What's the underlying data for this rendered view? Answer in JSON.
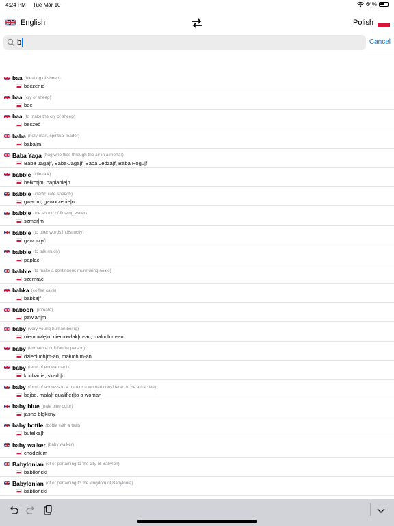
{
  "status_bar": {
    "time": "4:24 PM",
    "date": "Tue Mar 10",
    "battery_text": "64%",
    "battery_level": 0.64
  },
  "header": {
    "source_language": "English",
    "target_language": "Polish"
  },
  "search": {
    "value": "b",
    "placeholder": "",
    "cancel_label": "Cancel"
  },
  "results": [
    {
      "headword": "baa",
      "note": "(bleating of sheep)",
      "translation": "beczenie"
    },
    {
      "headword": "baa",
      "note": "(cry of sheep)",
      "translation": "bee"
    },
    {
      "headword": "baa",
      "note": "(to make the cry of sheep)",
      "translation": "beczeć"
    },
    {
      "headword": "baba",
      "note": "(holy man, spiritual leader)",
      "translation": "baba|m"
    },
    {
      "headword": "Baba Yaga",
      "note": "(hag who flies through the air in a mortar)",
      "translation": "Baba Jaga|f, Baba-Jaga|f, Baba Jędza|f, Baba Rogu|f"
    },
    {
      "headword": "babble",
      "note": "(idle talk)",
      "translation": "bełkot|m, paplanie|n"
    },
    {
      "headword": "babble",
      "note": "(inarticulate speech)",
      "translation": "gwar|m, gaworzenie|n"
    },
    {
      "headword": "babble",
      "note": "(the sound of flowing water)",
      "translation": "szmer|m"
    },
    {
      "headword": "babble",
      "note": "(to utter words indistinctly)",
      "translation": "gaworzyć"
    },
    {
      "headword": "babble",
      "note": "(to talk much)",
      "translation": "paplać"
    },
    {
      "headword": "babble",
      "note": "(to make a continuous murmuring noise)",
      "translation": "szemrać"
    },
    {
      "headword": "babka",
      "note": "(coffee cake)",
      "translation": "babka|f"
    },
    {
      "headword": "baboon",
      "note": "(primate)",
      "translation": "pawian|m"
    },
    {
      "headword": "baby",
      "note": "(very young human being)",
      "translation": "niemowlę|n, niemowlak|m-an, maluch|m-an"
    },
    {
      "headword": "baby",
      "note": "(immature or infantile person)",
      "translation": "dzieciuch|m-an, małuch|m-an"
    },
    {
      "headword": "baby",
      "note": "(term of endearment)",
      "translation": "kochanie, skarb|n"
    },
    {
      "headword": "baby",
      "note": "(form of address to a man or a woman considered to be attractive)",
      "translation": "bejbe, mała|f qualifier|to a woman"
    },
    {
      "headword": "baby blue",
      "note": "(pale blue color)",
      "translation": "jasno błękitny"
    },
    {
      "headword": "baby bottle",
      "note": "(bottle with a teat)",
      "translation": "butelka|f"
    },
    {
      "headword": "baby walker",
      "note": "(baby walker)",
      "translation": "chodzik|m"
    },
    {
      "headword": "Babylonian",
      "note": "(of or pertaining to the city of Babylon)",
      "translation": "babiloński"
    },
    {
      "headword": "Babylonian",
      "note": "(of or pertaining to the kingdom of Babylonia)",
      "translation": "babiloński"
    }
  ],
  "icons": {
    "swap": "swap-arrows-icon",
    "search": "search-icon",
    "undo": "undo-icon",
    "redo": "redo-icon",
    "paste": "clipboard-icon",
    "dismiss": "chevron-down-icon"
  },
  "colors": {
    "accent": "#007aff",
    "toolbar_bg": "#d1d3d9",
    "search_bg": "#ececed",
    "pl_red": "#dc143c"
  }
}
